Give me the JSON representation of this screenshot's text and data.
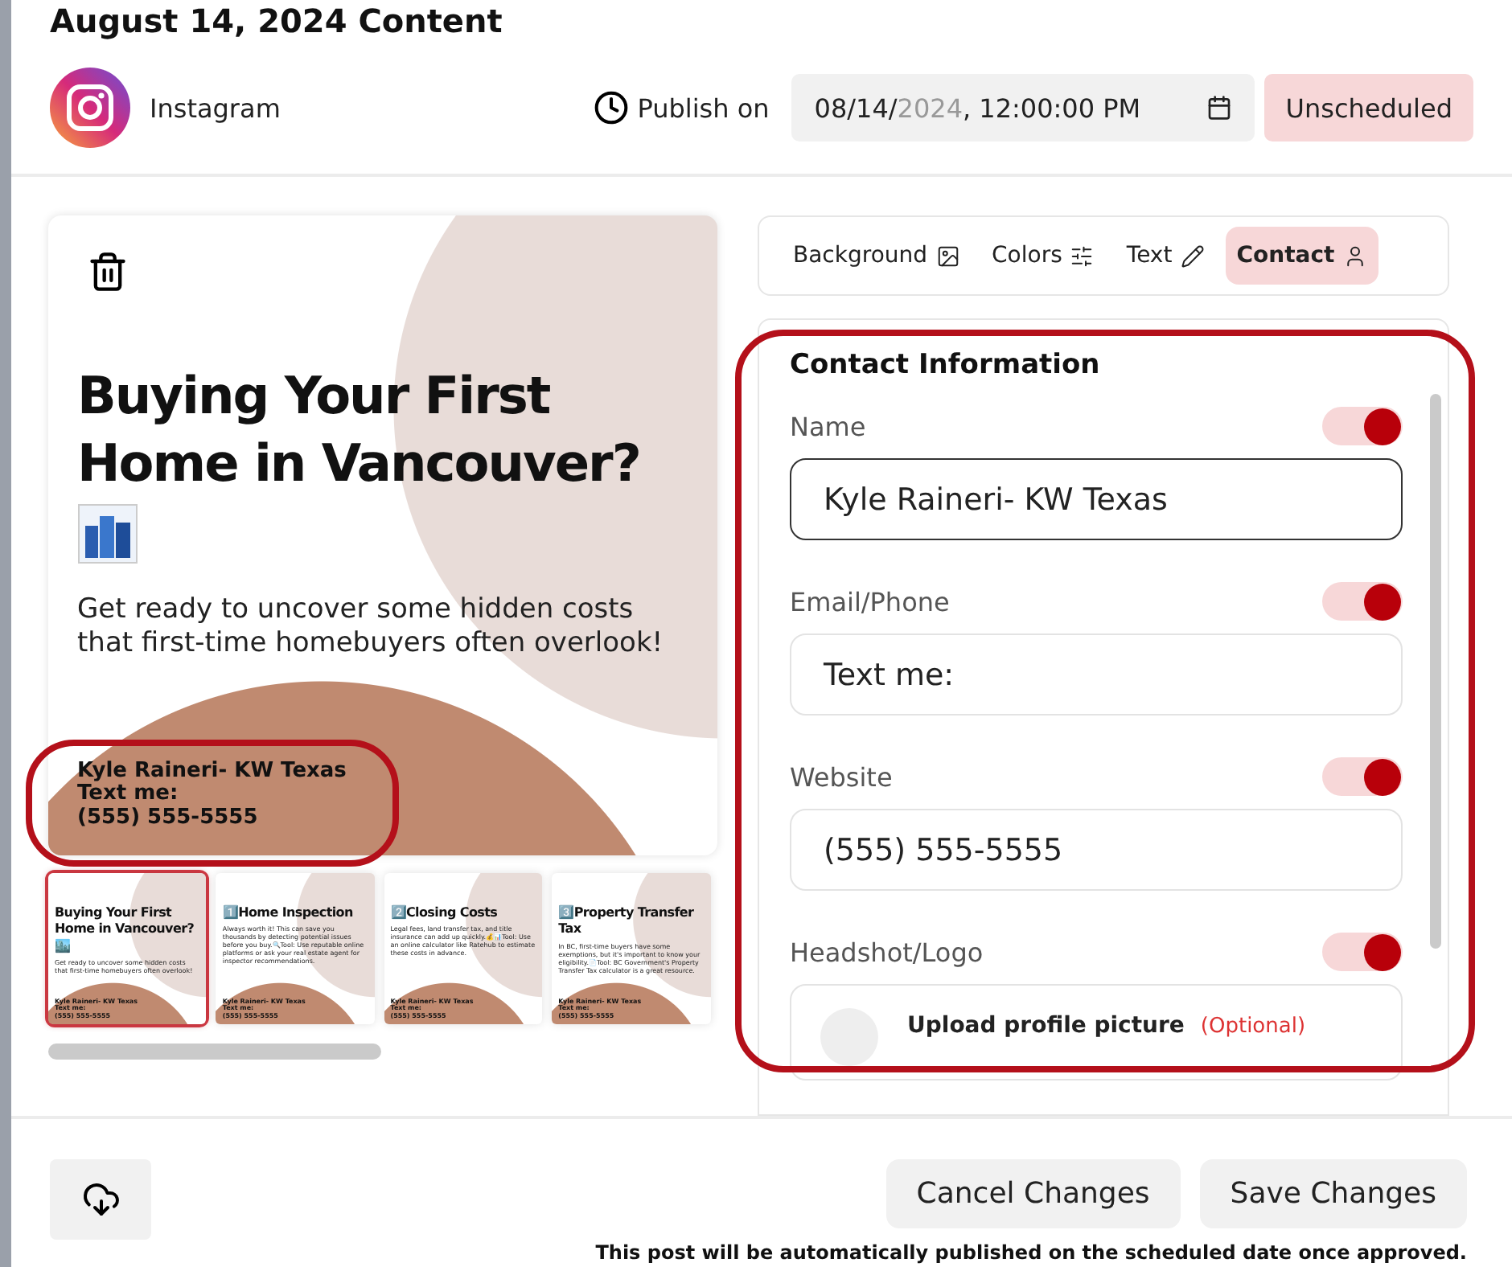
{
  "title": "August 14, 2024 Content",
  "platform": {
    "name": "Instagram"
  },
  "publish": {
    "label": "Publish on",
    "date_parts": [
      {
        "text": "08/14/",
        "muted": false
      },
      {
        "text": "2024",
        "muted": true
      },
      {
        "text": ", 12:00:00 PM",
        "muted": false
      }
    ],
    "status": "Unscheduled"
  },
  "preview": {
    "title": "Buying Your First Home in Vancouver?",
    "body": "Get ready to uncover some hidden costs that first-time homebuyers often overlook!",
    "contact": [
      "Kyle Raineri- KW Texas",
      "Text me:",
      "(555) 555-5555"
    ],
    "highlighted": true
  },
  "thumbnails": [
    {
      "title": "Buying Your First Home in Vancouver?🏙️",
      "body": "Get ready to uncover some hidden costs that first-time homebuyers often overlook!",
      "contact": [
        "Kyle Raineri- KW Texas",
        "Text me:",
        "(555) 555-5555"
      ],
      "selected": true
    },
    {
      "title": "1️⃣Home Inspection",
      "body": "Always worth it! This can save you thousands by detecting potential issues before you buy.🔍Tool: Use reputable online platforms or ask your real estate agent for inspector recommendations.",
      "contact": [
        "Kyle Raineri- KW Texas",
        "Text me:",
        "(555) 555-5555"
      ],
      "selected": false
    },
    {
      "title": "2️⃣Closing Costs",
      "body": "Legal fees, land transfer tax, and title insurance can add up quickly.💰📊Tool: Use an online calculator like Ratehub to estimate these costs in advance.",
      "contact": [
        "Kyle Raineri- KW Texas",
        "Text me:",
        "(555) 555-5555"
      ],
      "selected": false
    },
    {
      "title": "3️⃣Property Transfer Tax",
      "body": "In BC, first-time buyers have some exemptions, but it's important to know your eligibility.📄Tool: BC Government's Property Transfer Tax calculator is a great resource.",
      "contact": [
        "Kyle Raineri- KW Texas",
        "Text me:",
        "(555) 555-5555"
      ],
      "selected": false
    }
  ],
  "tabs": [
    {
      "label": "Background",
      "selected": false
    },
    {
      "label": "Colors",
      "selected": false
    },
    {
      "label": "Text",
      "selected": false
    },
    {
      "label": "Contact",
      "selected": true
    }
  ],
  "contact_panel": {
    "heading": "Contact Information",
    "highlighted": true,
    "fields": [
      {
        "label": "Name",
        "value": "Kyle Raineri- KW Texas",
        "on": true,
        "focused": true
      },
      {
        "label": "Email/Phone",
        "value": "Text me:",
        "on": true,
        "focused": false
      },
      {
        "label": "Website",
        "value": "(555) 555-5555",
        "on": true,
        "focused": false
      }
    ],
    "headshot": {
      "label": "Headshot/Logo",
      "on": true,
      "upload_text": "Upload profile picture",
      "optional_text": "(Optional)"
    }
  },
  "footer": {
    "buttons": [
      "Cancel Changes",
      "Save Changes"
    ],
    "note": "This post will be automatically published on the scheduled date once approved."
  }
}
